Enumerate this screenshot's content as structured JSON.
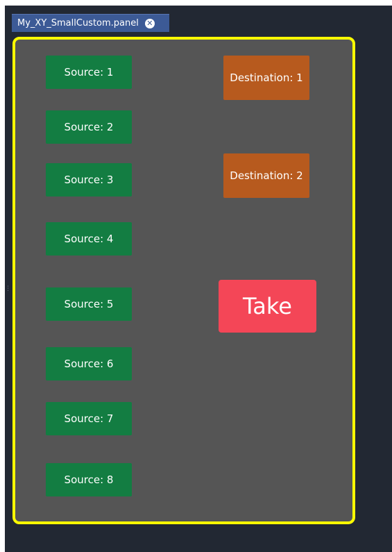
{
  "colors": {
    "background": "#222833",
    "panel": "#555555",
    "panel_border": "#ffff00",
    "tab": "#3c5a96",
    "source_button": "#137d42",
    "destination_button": "#b75a1e",
    "take_button": "#f44657"
  },
  "tab": {
    "label": "My_XY_SmallCustom.panel",
    "close_icon": "close-circle-icon"
  },
  "panel": {
    "sources": [
      {
        "label": "Source: 1"
      },
      {
        "label": "Source: 2"
      },
      {
        "label": "Source: 3"
      },
      {
        "label": "Source: 4"
      },
      {
        "label": "Source: 5"
      },
      {
        "label": "Source: 6"
      },
      {
        "label": "Source: 7"
      },
      {
        "label": "Source: 8"
      }
    ],
    "destinations": [
      {
        "label": "Destination: 1"
      },
      {
        "label": "Destination: 2"
      }
    ],
    "take_label": "Take"
  }
}
